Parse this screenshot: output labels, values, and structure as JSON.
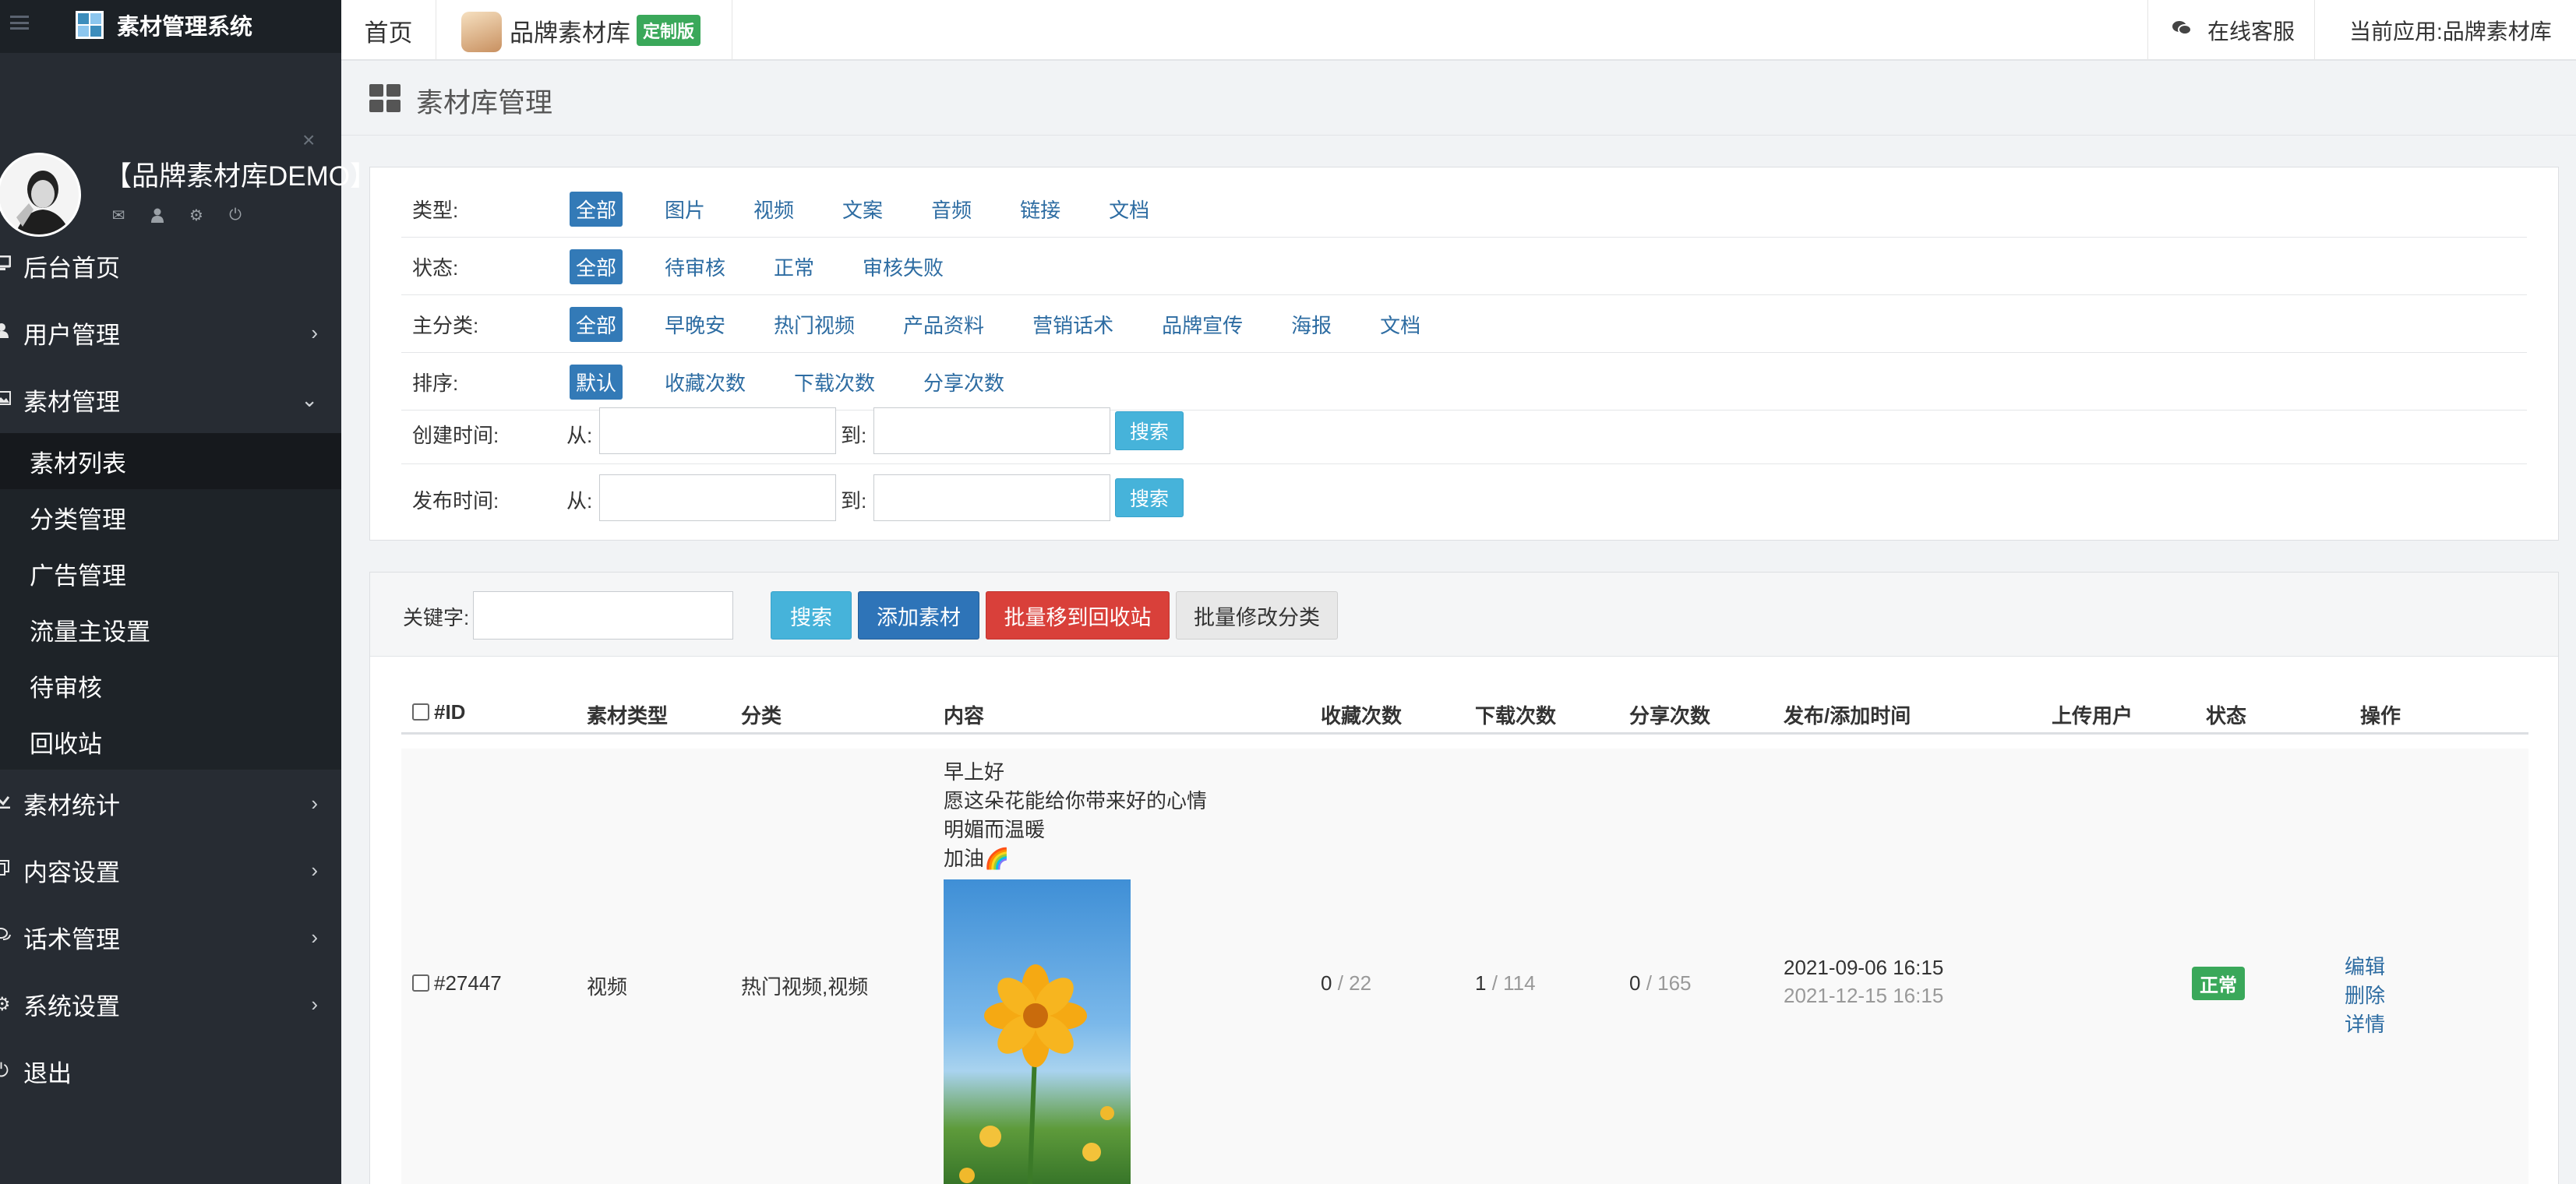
{
  "brand": {
    "name": "素材管理系统"
  },
  "profile": {
    "name": "【品牌素材库DEMO】",
    "close_glyph": "×"
  },
  "nav": {
    "items": [
      {
        "label": "后台首页",
        "icon": "desktop-icon"
      },
      {
        "label": "用户管理",
        "icon": "user-icon"
      },
      {
        "label": "素材管理",
        "icon": "image-icon"
      }
    ],
    "sub_items": [
      "素材列表",
      "分类管理",
      "广告管理",
      "流量主设置",
      "待审核",
      "回收站"
    ],
    "items_after": [
      {
        "label": "素材统计",
        "icon": "chart-icon"
      },
      {
        "label": "内容设置",
        "icon": "copy-icon"
      },
      {
        "label": "话术管理",
        "icon": "comments-icon"
      },
      {
        "label": "系统设置",
        "icon": "cog-icon"
      },
      {
        "label": "退出",
        "icon": "power-icon"
      }
    ]
  },
  "topbar": {
    "home": "首页",
    "app_name": "品牌素材库",
    "app_badge": "定制版",
    "online_service": "在线客服",
    "current_app": "当前应用:品牌素材库"
  },
  "page": {
    "title": "素材库管理"
  },
  "filters": {
    "type": {
      "label": "类型:",
      "options": [
        "全部",
        "图片",
        "视频",
        "文案",
        "音频",
        "链接",
        "文档"
      ]
    },
    "status": {
      "label": "状态:",
      "options": [
        "全部",
        "待审核",
        "正常",
        "审核失败"
      ]
    },
    "category": {
      "label": "主分类:",
      "options": [
        "全部",
        "早晚安",
        "热门视频",
        "产品资料",
        "营销话术",
        "品牌宣传",
        "海报",
        "文档"
      ]
    },
    "sort": {
      "label": "排序:",
      "options": [
        "默认",
        "收藏次数",
        "下载次数",
        "分享次数"
      ]
    },
    "created": {
      "label": "创建时间:",
      "from": "从:",
      "to": "到:",
      "button": "搜索"
    },
    "published": {
      "label": "发布时间:",
      "from": "从:",
      "to": "到:",
      "button": "搜索"
    }
  },
  "toolbar": {
    "keyword_label": "关键字:",
    "search": "搜索",
    "add": "添加素材",
    "recycle": "批量移到回收站",
    "batch_category": "批量修改分类"
  },
  "table": {
    "headers": [
      "#ID",
      "素材类型",
      "分类",
      "内容",
      "收藏次数",
      "下载次数",
      "分享次数",
      "发布/添加时间",
      "上传用户",
      "状态",
      "操作"
    ],
    "rows": [
      {
        "id": "#27447",
        "type": "视频",
        "category": "热门视频,视频",
        "content": [
          "早上好",
          "愿这朵花能给你带来好的心情",
          "明媚而温暖",
          "加油🌈"
        ],
        "fav": "0",
        "fav_total": " / 22",
        "download": "1",
        "download_total": " / 114",
        "share": "0",
        "share_total": " / 165",
        "publish_time": "2021-09-06 16:15",
        "add_time": "2021-12-15 16:15",
        "user": "",
        "status": "正常",
        "ops": [
          "编辑",
          "删除",
          "详情"
        ]
      }
    ]
  },
  "colors": {
    "sidebar": "#272c33",
    "primary": "#337ab7",
    "info": "#46b3da",
    "danger": "#d9403a",
    "success": "#3aa85a"
  }
}
